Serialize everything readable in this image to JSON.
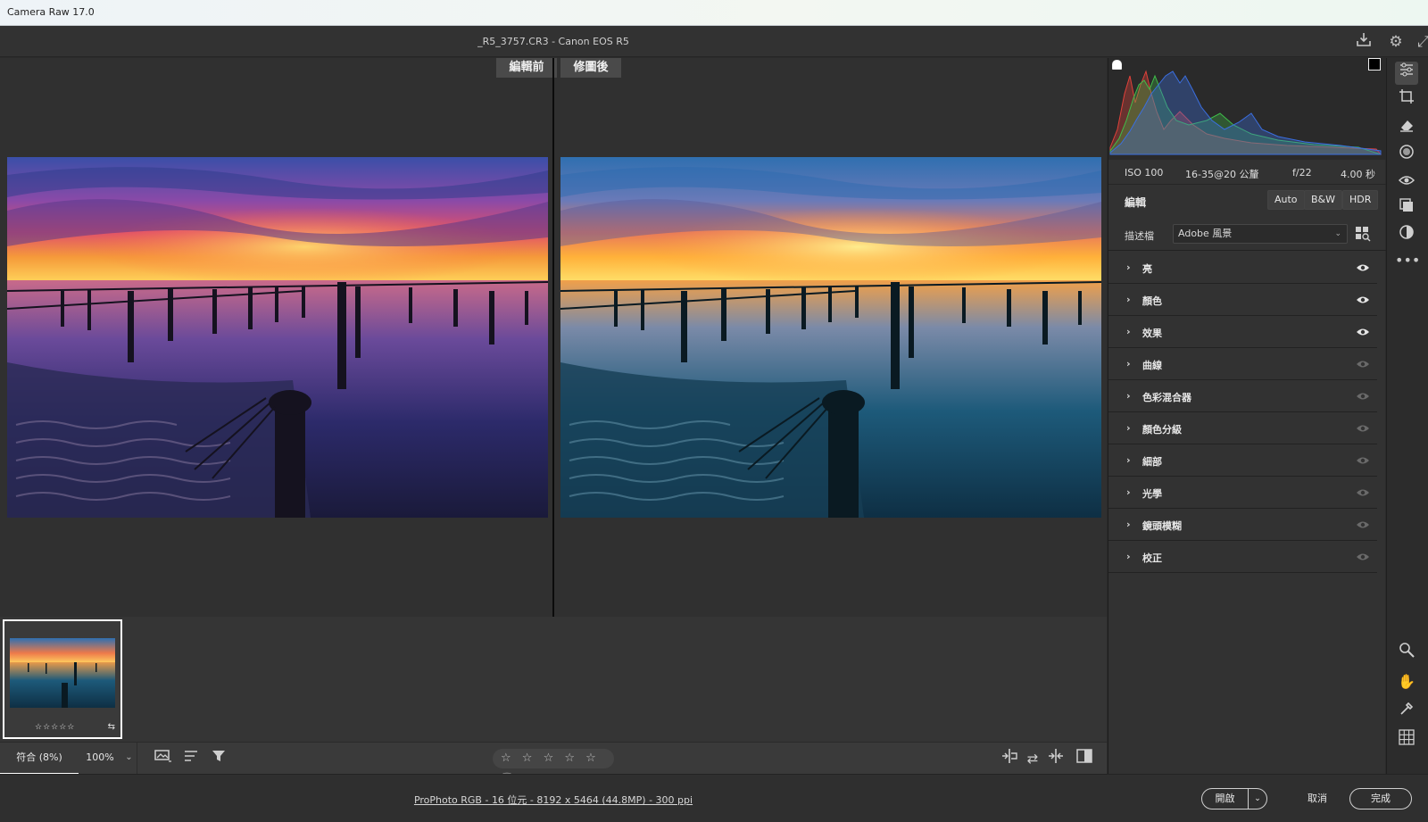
{
  "app": {
    "title": "Camera Raw 17.0"
  },
  "header": {
    "filename": "_R5_3757.CR3  -  Canon EOS R5"
  },
  "compare": {
    "before_label": "編輯前",
    "after_label": "修圖後"
  },
  "filmstrip": {
    "thumbnail_rating": "☆☆☆☆☆",
    "thumbnail_badge": "⇆"
  },
  "bottombar": {
    "fit_label": "符合 (8%)",
    "zoom_label": "100%",
    "rating_stars": "☆ ☆ ☆ ☆ ☆",
    "trash_icon": "🗑"
  },
  "status": {
    "info_link": "ProPhoto RGB - 16 位元 - 8192 x 5464 (44.8MP) - 300 ppi",
    "open_label": "開啟",
    "cancel_label": "取消",
    "done_label": "完成"
  },
  "exif": {
    "iso": "ISO 100",
    "lens": "16-35@20 公釐",
    "aperture": "f/22",
    "shutter": "4.00 秒"
  },
  "edit": {
    "title": "編輯",
    "auto_label": "Auto",
    "bw_label": "B&W",
    "hdr_label": "HDR",
    "profile_label": "描述檔",
    "profile_value": "Adobe 風景"
  },
  "sections": [
    {
      "label": "亮",
      "visible": true
    },
    {
      "label": "顏色",
      "visible": true
    },
    {
      "label": "效果",
      "visible": true
    },
    {
      "label": "曲線",
      "visible": false
    },
    {
      "label": "色彩混合器",
      "visible": false
    },
    {
      "label": "顏色分級",
      "visible": false
    },
    {
      "label": "細部",
      "visible": false
    },
    {
      "label": "光學",
      "visible": false
    },
    {
      "label": "鏡頭模糊",
      "visible": false
    },
    {
      "label": "校正",
      "visible": false
    }
  ],
  "colors": {
    "accent_white": "#ffffff",
    "panel_bg": "#323232",
    "histogram_red": "#e0413a",
    "histogram_green": "#3fbf4a",
    "histogram_blue": "#3b6fe0"
  }
}
